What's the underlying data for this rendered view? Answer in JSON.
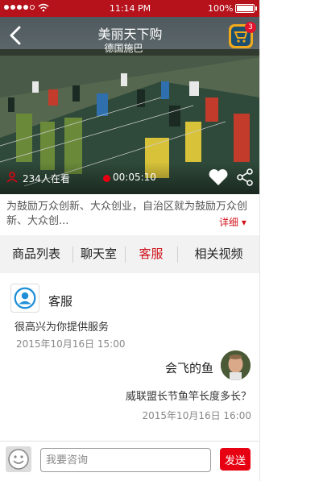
{
  "status_bar": {
    "time": "11:14 PM",
    "battery": "100%"
  },
  "header": {
    "title": "美丽天下购",
    "subtitle": "德国施巴",
    "cart_badge": "3"
  },
  "video": {
    "viewers": "234人在看",
    "duration": "00:05:10"
  },
  "description": {
    "text": "为鼓励万众创新、大众创业，自治区就为鼓励万众创新、大众创...",
    "detail_label": "详细"
  },
  "tabs": [
    {
      "label": "商品列表"
    },
    {
      "label": "聊天室"
    },
    {
      "label": "客服"
    },
    {
      "label": "相关视频"
    }
  ],
  "chat": {
    "service": {
      "name": "客服",
      "message": "很高兴为你提供服务",
      "time": "2015年10月16日 15:00"
    },
    "user": {
      "name": "会飞的鱼",
      "message": "威联盟长节鱼竿长度多长？",
      "time": "2015年10月16日 16:00"
    }
  },
  "input": {
    "placeholder": "我要咨询",
    "send_label": "发送"
  },
  "colors": {
    "brand_red": "#e60012",
    "status_bar": "#b5121b"
  }
}
